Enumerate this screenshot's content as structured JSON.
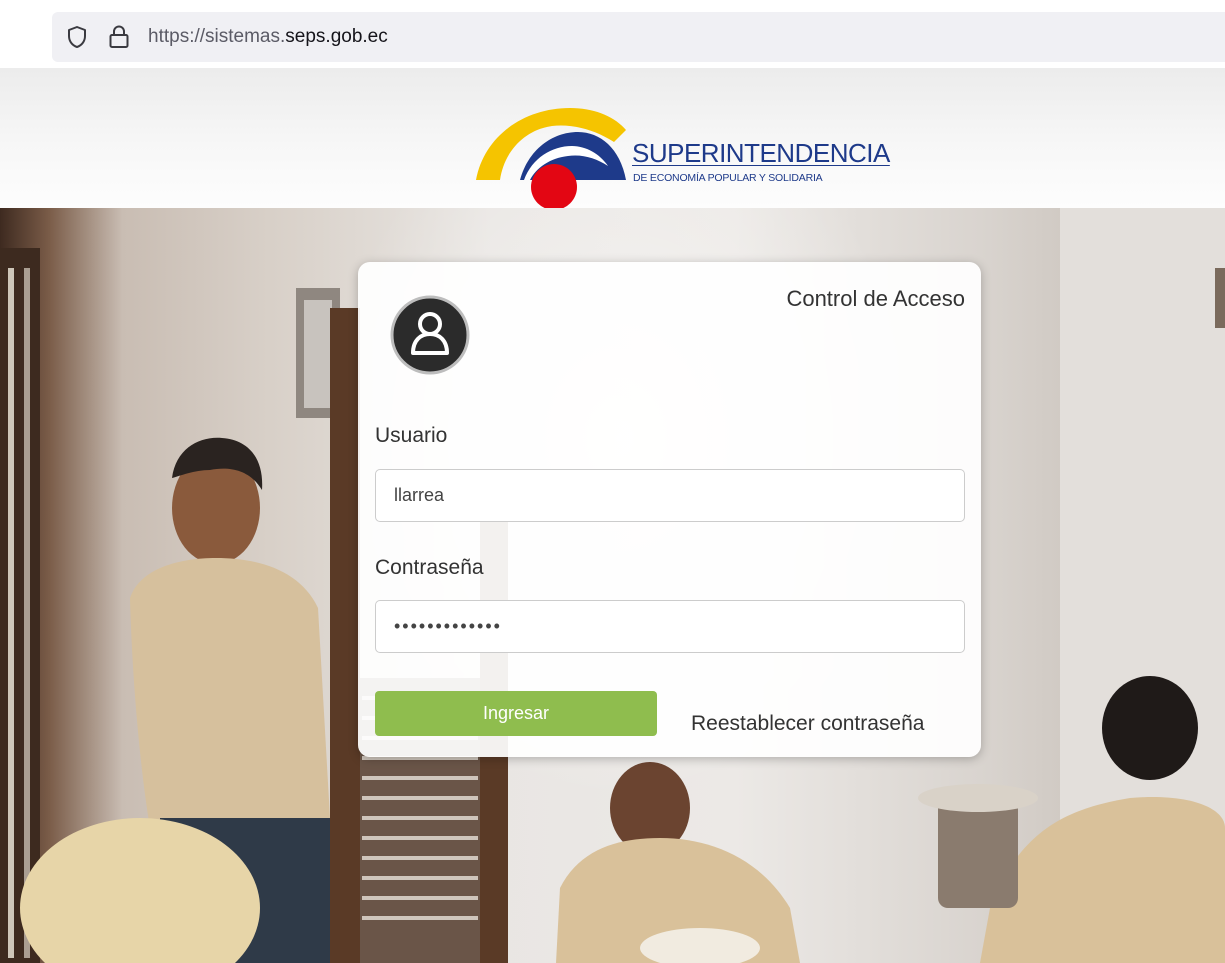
{
  "browser": {
    "url_prefix": "https://sistemas.",
    "url_host": "seps.gob.ec",
    "icons": [
      "shield-icon",
      "lock-icon"
    ]
  },
  "header": {
    "logo_title": "SUPERINTENDENCIA",
    "logo_subtitle": "DE ECONOMÍA POPULAR Y SOLIDARIA",
    "logo_colors": {
      "yellow": "#f5c400",
      "blue": "#1e3a8a",
      "red": "#e30613"
    }
  },
  "login": {
    "title": "Control de Acceso",
    "avatar_icon": "user-icon",
    "user_label": "Usuario",
    "user_value": "llarrea",
    "password_label": "Contraseña",
    "password_value": "•••••••••••••",
    "submit_label": "Ingresar",
    "reset_label": "Reestablecer contraseña",
    "accent_color": "#8fbd4e"
  }
}
